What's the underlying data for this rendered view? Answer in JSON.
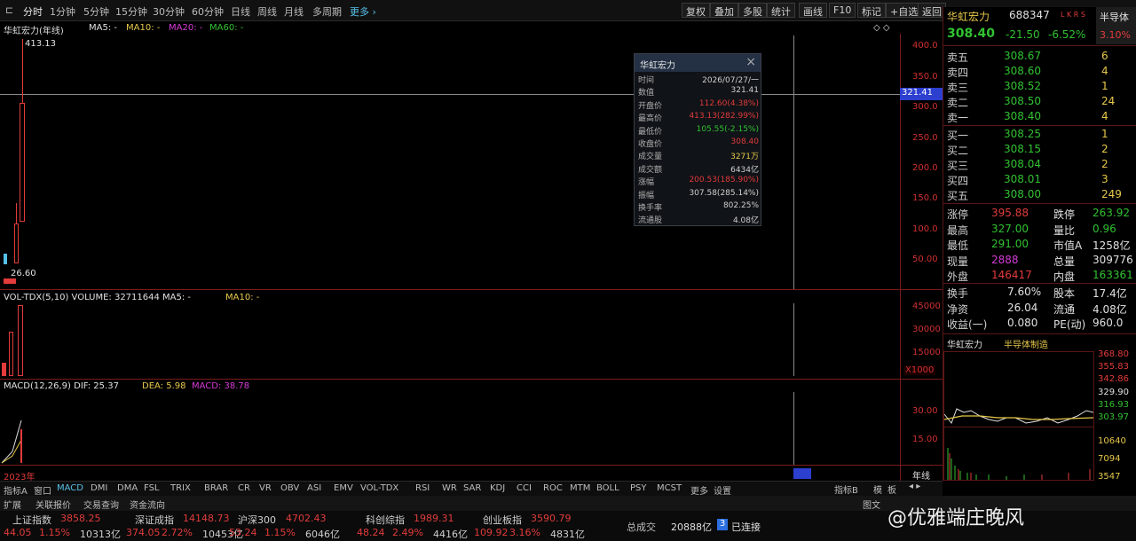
{
  "toolbar": {
    "left": [
      "分时",
      "1分钟",
      "5分钟",
      "15分钟",
      "30分钟",
      "60分钟",
      "日线",
      "周线",
      "月线",
      "多周期",
      "更多 ›"
    ],
    "right": [
      "复权",
      "叠加",
      "多股",
      "统计",
      "画线",
      "F10",
      "标记",
      "+自选",
      "返回"
    ]
  },
  "main": {
    "stock_title": "华虹宏力(年线)",
    "ma5": "MA5: -",
    "ma10": "MA10: -",
    "ma20": "MA20: -",
    "ma60": "MA60: -",
    "high_mark": "413.13",
    "low_mark": "26.60",
    "cursor_price": "321.41",
    "price_axis": [
      "400.0",
      "350.0",
      "300.0",
      "250.0",
      "200.0",
      "150.0",
      "100.0",
      "50.00"
    ],
    "vol_label": "VOL-TDX(5,10) VOLUME: 32711644 MA5: -",
    "vol_ma10": "MA10: -",
    "vol_axis": [
      "45000",
      "30000",
      "15000"
    ],
    "vol_unit": "X1000",
    "macd_label": "MACD(12,26,9) DIF: 25.37",
    "macd_dea": "DEA: 5.98",
    "macd_val": "MACD: 38.78",
    "macd_axis": [
      "30.00",
      "15.00"
    ],
    "year_label": "2023年",
    "period_btn": "年线"
  },
  "tooltip": {
    "title": "华虹宏力",
    "rows": [
      {
        "k": "时间",
        "v": "2026/07/27/一",
        "c": "#cfcfcf"
      },
      {
        "k": "数值",
        "v": "321.41",
        "c": "#cfcfcf"
      },
      {
        "k": "开盘价",
        "v": "112.60(4.38%)",
        "c": "#e23b3b"
      },
      {
        "k": "最高价",
        "v": "413.13(282.99%)",
        "c": "#e23b3b"
      },
      {
        "k": "最低价",
        "v": "105.55(-2.15%)",
        "c": "#31c231"
      },
      {
        "k": "收盘价",
        "v": "308.40",
        "c": "#e23b3b"
      },
      {
        "k": "成交量",
        "v": "3271万",
        "c": "#e6c84a"
      },
      {
        "k": "成交额",
        "v": "6434亿",
        "c": "#cfcfcf"
      },
      {
        "k": "涨幅",
        "v": "200.53(185.90%)",
        "c": "#e23b3b"
      },
      {
        "k": "振幅",
        "v": "307.58(285.14%)",
        "c": "#cfcfcf"
      },
      {
        "k": "换手率",
        "v": "802.25%",
        "c": "#cfcfcf"
      },
      {
        "k": "流通股",
        "v": "4.08亿",
        "c": "#cfcfcf"
      }
    ]
  },
  "quote": {
    "name": "华虹宏力",
    "code": "688347",
    "tag": "L K R S",
    "sector_btn": "半导体",
    "sector_pct": "3.10%",
    "price": "308.40",
    "chg": "-21.50",
    "pct": "-6.52%",
    "sells": [
      {
        "k": "卖五",
        "p": "308.67",
        "v": "6"
      },
      {
        "k": "卖四",
        "p": "308.60",
        "v": "4"
      },
      {
        "k": "卖三",
        "p": "308.52",
        "v": "1"
      },
      {
        "k": "卖二",
        "p": "308.50",
        "v": "24"
      },
      {
        "k": "卖一",
        "p": "308.40",
        "v": "4"
      }
    ],
    "buys": [
      {
        "k": "买一",
        "p": "308.25",
        "v": "1"
      },
      {
        "k": "买二",
        "p": "308.15",
        "v": "2"
      },
      {
        "k": "买三",
        "p": "308.04",
        "v": "2"
      },
      {
        "k": "买四",
        "p": "308.01",
        "v": "3"
      },
      {
        "k": "买五",
        "p": "308.00",
        "v": "249"
      }
    ],
    "stats": [
      {
        "k1": "涨停",
        "v1": "395.88",
        "c1": "#e23b3b",
        "k2": "跌停",
        "v2": "263.92",
        "c2": "#31c231"
      },
      {
        "k1": "最高",
        "v1": "327.00",
        "c1": "#31c231",
        "k2": "量比",
        "v2": "0.96",
        "c2": "#31c231"
      },
      {
        "k1": "最低",
        "v1": "291.00",
        "c1": "#31c231",
        "k2": "市值A",
        "v2": "1258亿",
        "c2": "#e0e0e0"
      },
      {
        "k1": "现量",
        "v1": "2888",
        "c1": "#d63ad6",
        "k2": "总量",
        "v2": "309776",
        "c2": "#e0e0e0"
      },
      {
        "k1": "外盘",
        "v1": "146417",
        "c1": "#e23b3b",
        "k2": "内盘",
        "v2": "163361",
        "c2": "#31c231"
      }
    ],
    "stats2": [
      {
        "k1": "换手",
        "v1": "7.60%",
        "k2": "股本",
        "v2": "17.4亿"
      },
      {
        "k1": "净资",
        "v1": "26.04",
        "k2": "流通",
        "v2": "4.08亿"
      },
      {
        "k1": "收益(一)",
        "v1": "0.080",
        "k2": "PE(动)",
        "v2": "960.0"
      }
    ],
    "mini_name": "华虹宏力",
    "mini_sector": "半导体制造",
    "mini_axis_r": [
      "368.80",
      "355.83",
      "342.86",
      "329.90",
      "316.93",
      "303.97"
    ],
    "mini_vol_axis": [
      "10640",
      "7094",
      "3547"
    ]
  },
  "bottom_tabs": [
    "指标A",
    "窗口",
    "MACD",
    "DMI",
    "DMA",
    "FSL",
    "TRIX",
    "BRAR",
    "CR",
    "VR",
    "OBV",
    "ASI",
    "EMV",
    "VOL-TDX",
    "RSI",
    "WR",
    "SAR",
    "KDJ",
    "CCI",
    "ROC",
    "MTM",
    "BOLL",
    "PSY",
    "MCST",
    "更多",
    "设置"
  ],
  "bottom_right": [
    "指标B",
    "模",
    "板"
  ],
  "sub_tabs": [
    "扩展",
    "关联报价",
    "交易查询",
    "资金流向"
  ],
  "tickers": [
    {
      "name": "上证指数",
      "val": "3858.25",
      "chg": "44.05",
      "pct": "1.15%",
      "amt": "10313亿"
    },
    {
      "name": "深证成指",
      "val": "14148.73",
      "chg": "374.05",
      "pct": "2.72%",
      "amt": "10453亿"
    },
    {
      "name": "沪深300",
      "val": "4702.43",
      "chg": "53.24",
      "pct": "1.15%",
      "amt": "6046亿"
    },
    {
      "name": "科创综指",
      "val": "1989.31",
      "chg": "48.24",
      "pct": "2.49%",
      "amt": "4416亿"
    },
    {
      "name": "创业板指",
      "val": "3590.79",
      "chg": "109.92",
      "pct": "3.16%",
      "amt": "4831亿"
    }
  ],
  "total_label": "总成交",
  "total_val": "20888亿",
  "conn_num": "3",
  "conn_label": "已连接",
  "watermark": "@优雅端庄晚风",
  "f_btn": "图文"
}
